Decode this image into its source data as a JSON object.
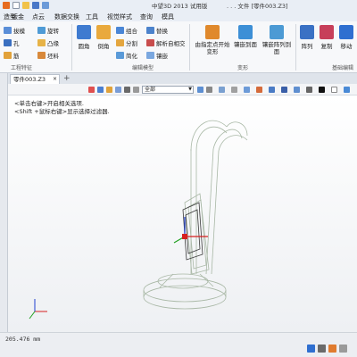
{
  "titlebar": {
    "title": "中望3D 2013 试用版",
    "file_title": ". . . 文件 [零件003.Z3]"
  },
  "menubar": {
    "items": [
      "造型",
      "钣金",
      "点云",
      "数据交换",
      "工具",
      "视觉样式",
      "查询",
      "模具"
    ]
  },
  "ribbon": {
    "feature_small": [
      "拔模",
      "孔",
      "筋",
      "旋转",
      "凸缘",
      "坯料"
    ],
    "edit_big": [
      "圆角",
      "倒角"
    ],
    "edit_small": [
      "组合",
      "分割",
      "简化",
      "替换",
      "解析自相交",
      "镶嵌"
    ],
    "deform_big": [
      "由指定点开始变形",
      "镶嵌到面",
      "镶嵌阵列到面"
    ],
    "basic_big": [
      "阵列",
      "复制",
      "移动"
    ],
    "group_labels": [
      "工程特征",
      "编辑模型",
      "变形",
      "基础编辑"
    ]
  },
  "tabs": {
    "doc_tab": "零件003.Z3",
    "add_label": "+"
  },
  "viewbar": {
    "filter_value": "全部"
  },
  "viewport": {
    "hint_line1": "<单击右键>开启相关选项.",
    "hint_line2": "<Shift +鼠标右键>显示选择过滤器."
  },
  "status": {
    "coordinate_text": "205.476 mm"
  },
  "colors": {
    "ribbon_bg": "#f7f8fa",
    "accent_blue": "#2f6fd0",
    "model_line": "#a9b8a6",
    "axis_x": "#d62020",
    "axis_y": "#20a020",
    "axis_z": "#2040d0"
  }
}
